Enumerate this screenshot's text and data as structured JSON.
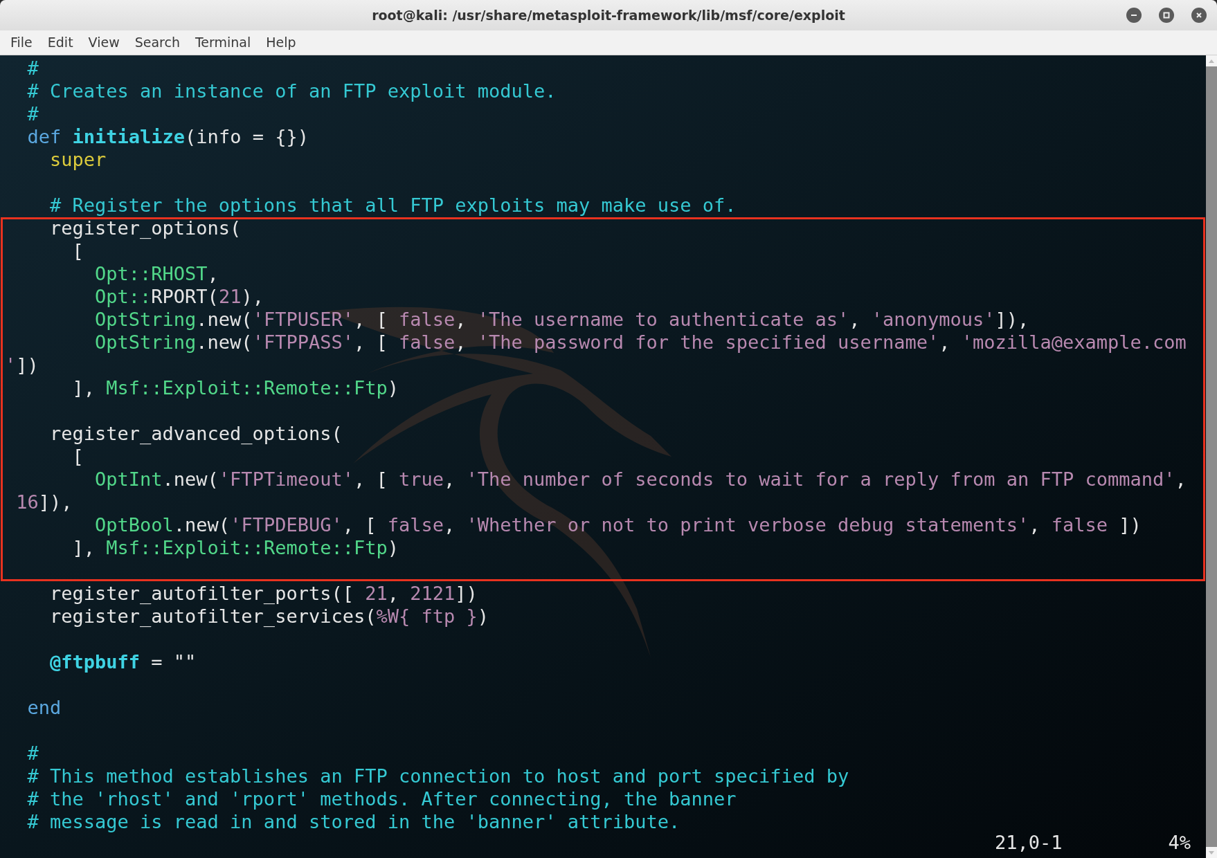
{
  "window": {
    "title": "root@kali: /usr/share/metasploit-framework/lib/msf/core/exploit"
  },
  "menu": [
    "File",
    "Edit",
    "View",
    "Search",
    "Terminal",
    "Help"
  ],
  "blocks": [
    {
      "highlighted": false,
      "lines": [
        {
          "kind": "code",
          "tokens": [
            {
              "kind": "comment",
              "text": "  #"
            }
          ]
        },
        {
          "kind": "code",
          "tokens": [
            {
              "kind": "comment",
              "text": "  # Creates an instance of an FTP exploit module."
            }
          ]
        },
        {
          "kind": "code",
          "tokens": [
            {
              "kind": "comment",
              "text": "  #"
            }
          ]
        },
        {
          "kind": "code",
          "tokens": [
            {
              "kind": "keyword",
              "text": "  def "
            },
            {
              "kind": "function",
              "text": "initialize"
            },
            {
              "kind": "plain",
              "text": "(info = {})"
            }
          ]
        },
        {
          "kind": "code",
          "tokens": [
            {
              "kind": "builtin",
              "text": "    super"
            }
          ]
        },
        {
          "kind": "blank"
        },
        {
          "kind": "code",
          "tokens": [
            {
              "kind": "comment",
              "text": "    # Register the options that all FTP exploits may make use of."
            }
          ]
        }
      ]
    },
    {
      "highlighted": true,
      "lines": [
        {
          "kind": "code",
          "tokens": [
            {
              "kind": "plain",
              "text": "    register_options("
            }
          ]
        },
        {
          "kind": "code",
          "tokens": [
            {
              "kind": "plain",
              "text": "      ["
            }
          ]
        },
        {
          "kind": "code",
          "tokens": [
            {
              "kind": "constant",
              "text": "        Opt::RHOST"
            },
            {
              "kind": "plain",
              "text": ","
            }
          ]
        },
        {
          "kind": "code",
          "tokens": [
            {
              "kind": "constant",
              "text": "        Opt::"
            },
            {
              "kind": "plain",
              "text": "RPORT("
            },
            {
              "kind": "number",
              "text": "21"
            },
            {
              "kind": "plain",
              "text": "),"
            }
          ]
        },
        {
          "kind": "code",
          "tokens": [
            {
              "kind": "constant",
              "text": "        OptString"
            },
            {
              "kind": "plain",
              "text": ".new("
            },
            {
              "kind": "string",
              "text": "'FTPUSER'"
            },
            {
              "kind": "plain",
              "text": ", [ "
            },
            {
              "kind": "boolean",
              "text": "false"
            },
            {
              "kind": "plain",
              "text": ", "
            },
            {
              "kind": "string",
              "text": "'The username to authenticate as'"
            },
            {
              "kind": "plain",
              "text": ", "
            },
            {
              "kind": "string",
              "text": "'anonymous'"
            },
            {
              "kind": "plain",
              "text": "]),"
            }
          ]
        },
        {
          "kind": "code",
          "tokens": [
            {
              "kind": "constant",
              "text": "        OptString"
            },
            {
              "kind": "plain",
              "text": ".new("
            },
            {
              "kind": "string",
              "text": "'FTPPASS'"
            },
            {
              "kind": "plain",
              "text": ", [ "
            },
            {
              "kind": "boolean",
              "text": "false"
            },
            {
              "kind": "plain",
              "text": ", "
            },
            {
              "kind": "string",
              "text": "'The password for the specified username'"
            },
            {
              "kind": "plain",
              "text": ", "
            },
            {
              "kind": "string",
              "text": "'mozilla@example.com"
            }
          ]
        },
        {
          "kind": "code",
          "tokens": [
            {
              "kind": "string",
              "text": "'"
            },
            {
              "kind": "plain",
              "text": "])"
            }
          ]
        },
        {
          "kind": "code",
          "tokens": [
            {
              "kind": "plain",
              "text": "      ], "
            },
            {
              "kind": "constant",
              "text": "Msf::Exploit::Remote::Ftp"
            },
            {
              "kind": "plain",
              "text": ")"
            }
          ]
        },
        {
          "kind": "blank"
        },
        {
          "kind": "code",
          "tokens": [
            {
              "kind": "plain",
              "text": "    register_advanced_options("
            }
          ]
        },
        {
          "kind": "code",
          "tokens": [
            {
              "kind": "plain",
              "text": "      ["
            }
          ]
        },
        {
          "kind": "code",
          "tokens": [
            {
              "kind": "constant",
              "text": "        OptInt"
            },
            {
              "kind": "plain",
              "text": ".new("
            },
            {
              "kind": "string",
              "text": "'FTPTimeout'"
            },
            {
              "kind": "plain",
              "text": ", [ "
            },
            {
              "kind": "boolean",
              "text": "true"
            },
            {
              "kind": "plain",
              "text": ", "
            },
            {
              "kind": "string",
              "text": "'The number of seconds to wait for a reply from an FTP command'"
            },
            {
              "kind": "plain",
              "text": ","
            }
          ]
        },
        {
          "kind": "code",
          "tokens": [
            {
              "kind": "number",
              "text": " 16"
            },
            {
              "kind": "plain",
              "text": "]),"
            }
          ]
        },
        {
          "kind": "code",
          "tokens": [
            {
              "kind": "constant",
              "text": "        OptBool"
            },
            {
              "kind": "plain",
              "text": ".new("
            },
            {
              "kind": "string",
              "text": "'FTPDEBUG'"
            },
            {
              "kind": "plain",
              "text": ", [ "
            },
            {
              "kind": "boolean",
              "text": "false"
            },
            {
              "kind": "plain",
              "text": ", "
            },
            {
              "kind": "string",
              "text": "'Whether or not to print verbose debug statements'"
            },
            {
              "kind": "plain",
              "text": ", "
            },
            {
              "kind": "boolean",
              "text": "false"
            },
            {
              "kind": "plain",
              "text": " ])"
            }
          ]
        },
        {
          "kind": "code",
          "tokens": [
            {
              "kind": "plain",
              "text": "      ], "
            },
            {
              "kind": "constant",
              "text": "Msf::Exploit::Remote::Ftp"
            },
            {
              "kind": "plain",
              "text": ")"
            }
          ]
        },
        {
          "kind": "blank"
        }
      ]
    },
    {
      "highlighted": false,
      "lines": [
        {
          "kind": "code",
          "tokens": [
            {
              "kind": "plain",
              "text": "    register_autofilter_ports([ "
            },
            {
              "kind": "number",
              "text": "21"
            },
            {
              "kind": "plain",
              "text": ", "
            },
            {
              "kind": "number",
              "text": "2121"
            },
            {
              "kind": "plain",
              "text": "])"
            }
          ]
        },
        {
          "kind": "code",
          "tokens": [
            {
              "kind": "plain",
              "text": "    register_autofilter_services("
            },
            {
              "kind": "string",
              "text": "%W{ ftp }"
            },
            {
              "kind": "plain",
              "text": ")"
            }
          ]
        },
        {
          "kind": "blank"
        },
        {
          "kind": "code",
          "tokens": [
            {
              "kind": "ivar",
              "text": "    @ftpbuff"
            },
            {
              "kind": "plain",
              "text": " = \"\""
            }
          ]
        },
        {
          "kind": "blank"
        },
        {
          "kind": "code",
          "tokens": [
            {
              "kind": "keyword",
              "text": "  end"
            }
          ]
        },
        {
          "kind": "blank"
        },
        {
          "kind": "code",
          "tokens": [
            {
              "kind": "comment",
              "text": "  #"
            }
          ]
        },
        {
          "kind": "code",
          "tokens": [
            {
              "kind": "comment",
              "text": "  # This method establishes an FTP connection to host and port specified by"
            }
          ]
        },
        {
          "kind": "code",
          "tokens": [
            {
              "kind": "comment",
              "text": "  # the 'rhost' and 'rport' methods. After connecting, the banner"
            }
          ]
        },
        {
          "kind": "code",
          "tokens": [
            {
              "kind": "comment",
              "text": "  # message is read in and stored in the 'banner' attribute."
            }
          ]
        }
      ]
    }
  ],
  "status": {
    "position": "21,0-1",
    "scroll": "4%"
  }
}
